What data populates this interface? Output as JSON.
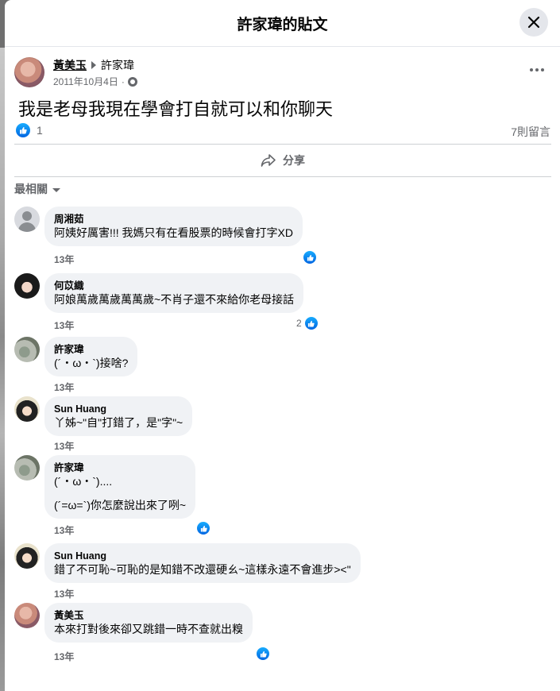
{
  "dialog": {
    "title": "許家瑋的貼文"
  },
  "post": {
    "author": "黃美玉",
    "target": "許家瑋",
    "date": "2011年10月4日",
    "separator": "·",
    "text": "我是老母我現在學會打自就可以和你聊天",
    "like_count": "1",
    "comment_count": "7則留言",
    "share_label": "分享"
  },
  "sort": {
    "label": "最相關"
  },
  "comments": [
    {
      "name": "周湘茹",
      "text": "阿姨好厲害!!! 我媽只有在看股票的時候會打字XD",
      "time": "13年",
      "reactions": ""
    },
    {
      "name": "何苡織",
      "text": "阿娘萬歲萬歲萬萬歲~不肖子還不來給你老母接話",
      "time": "13年",
      "reactions": "2"
    },
    {
      "name": "許家瑋",
      "text": "(´・ω・`)接啥?",
      "time": "13年",
      "reactions": ""
    },
    {
      "name": "Sun Huang",
      "text": "丫姊~\"自\"打錯了，是\"字\"~",
      "time": "13年",
      "reactions": ""
    },
    {
      "name": "許家瑋",
      "text": "(´・ω・`)....",
      "text2": "(´=ω=`)你怎麼說出來了咧~",
      "time": "13年",
      "reactions": ""
    },
    {
      "name": "Sun Huang",
      "text": "錯了不可恥~可恥的是知錯不改還硬ㄠ~這樣永遠不會進步><\"",
      "time": "13年",
      "reactions": ""
    },
    {
      "name": "黃美玉",
      "text": "本來打對後來卻又跳錯一時不查就出糗",
      "time": "13年",
      "reactions": ""
    }
  ],
  "colors": {
    "accent_blue": "#0866ff",
    "bubble_bg": "#f0f2f5",
    "secondary_text": "#65676b"
  }
}
